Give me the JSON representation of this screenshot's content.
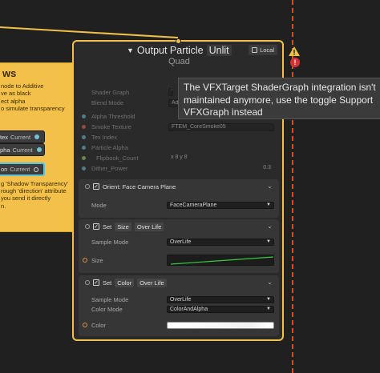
{
  "sticky_note": {
    "title": "ws",
    "lines": [
      "node to Additive",
      "ve as black",
      "ect alpha",
      "o simulate transparency",
      "",
      "",
      "",
      "",
      "",
      "",
      "",
      "",
      "",
      "g 'Shadow Transparency'",
      "rough 'direction' attribute",
      "you send it directly",
      "n."
    ]
  },
  "property_nodes": [
    {
      "name": "tex",
      "value": "Current"
    },
    {
      "name": "pha",
      "value": "Current"
    },
    {
      "name": "on",
      "value": "Current"
    }
  ],
  "output_node": {
    "title": "Output Particle",
    "badge": "Unlit",
    "subtitle": "Quad",
    "space_label": "Local",
    "properties": [
      {
        "label": "Shader Graph",
        "value": "V",
        "dim": true
      },
      {
        "label": "Blend Mode",
        "value": "Add",
        "dim": true
      },
      {
        "label": "Alpha Threshold",
        "value": "",
        "dim": true
      },
      {
        "label": "Smoke Texture",
        "value": "FTEM_CoreSmoke05",
        "dim": true
      },
      {
        "label": "Tex Index",
        "value": "",
        "dim": true
      },
      {
        "label": "Particle Alpha",
        "value": "",
        "dim": true
      },
      {
        "label": "Flipbook_Count",
        "value": "x 8          y 8",
        "dim": true
      },
      {
        "label": "Dither_Power",
        "value": "0.3",
        "dim": true
      }
    ],
    "blocks": [
      {
        "title": "Orient: Face Camera Plane",
        "chips": [],
        "rows": [
          {
            "label": "Mode",
            "value": "FaceCameraPlane"
          }
        ]
      },
      {
        "title": "Set",
        "chips": [
          "Size",
          "Over Life"
        ],
        "rows": [
          {
            "label": "Sample Mode",
            "value": "OverLife"
          },
          {
            "label": "Size",
            "value": ""
          }
        ]
      },
      {
        "title": "Set",
        "chips": [
          "Color",
          "Over Life"
        ],
        "rows": [
          {
            "label": "Sample Mode",
            "value": "OverLife"
          },
          {
            "label": "Color Mode",
            "value": "ColorAndAlpha"
          },
          {
            "label": "Color",
            "value": ""
          }
        ]
      }
    ]
  },
  "tooltip": {
    "line1": "The VFXTarget ShaderGraph integration isn't",
    "line2": "maintained anymore, use the toggle Support",
    "line3": "VFXGraph instead"
  },
  "colors": {
    "node_border": "#f2c048",
    "sticky": "#f3c04a",
    "wire": "#6ec3d6",
    "dashed_line": "#d3541e",
    "error": "#d63131",
    "warning": "#f0c040"
  },
  "icons": [
    "funnel-icon",
    "local-space-icon",
    "warning-icon",
    "error-icon",
    "checkbox-icon",
    "chevron-down-icon"
  ]
}
